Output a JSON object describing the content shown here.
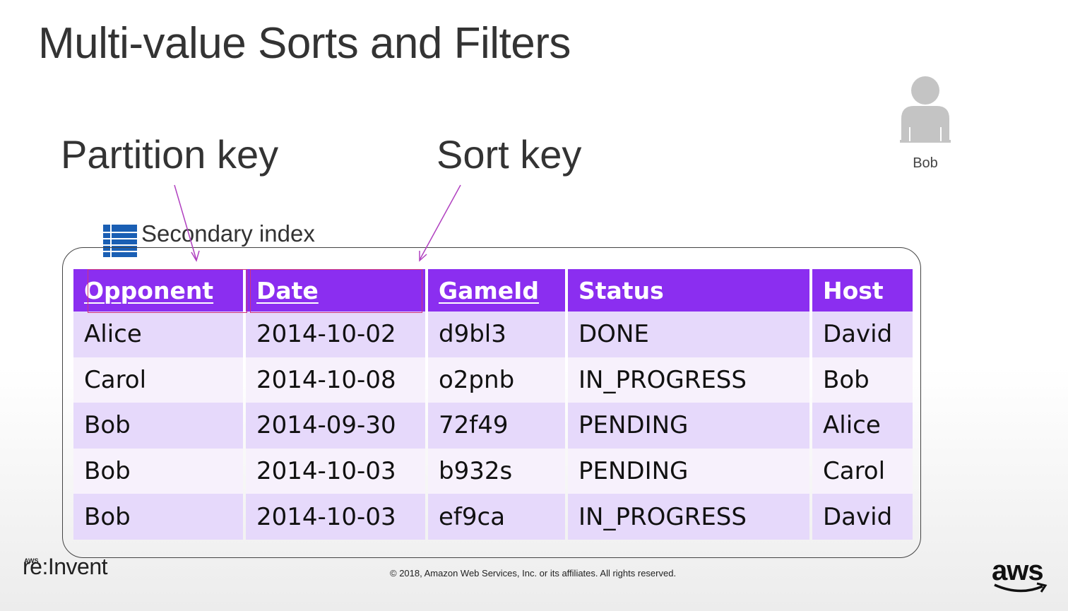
{
  "slide": {
    "title": "Multi-value Sorts and Filters",
    "partition_key_label": "Partition key",
    "sort_key_label": "Sort key",
    "index_label": "Secondary index",
    "user_name": "Bob",
    "copyright": "© 2018, Amazon Web Services, Inc. or its affiliates. All rights reserved.",
    "event_logo": "re:Invent",
    "event_logo_small": "AWS",
    "brand_logo": "aws"
  },
  "table": {
    "headers": [
      "Opponent",
      "Date",
      "GameId",
      "Status",
      "Host"
    ],
    "rows": [
      [
        "Alice",
        "2014-10-02",
        "d9bl3",
        "DONE",
        "David"
      ],
      [
        "Carol",
        "2014-10-08",
        "o2pnb",
        "IN_PROGRESS",
        "Bob"
      ],
      [
        "Bob",
        "2014-09-30",
        "72f49",
        "PENDING",
        "Alice"
      ],
      [
        "Bob",
        "2014-10-03",
        "b932s",
        "PENDING",
        "Carol"
      ],
      [
        "Bob",
        "2014-10-03",
        "ef9ca",
        "IN_PROGRESS",
        "David"
      ]
    ]
  },
  "colors": {
    "header_bg": "#8b2ef0",
    "row_dark": "#e6d9fb",
    "row_light": "#f7f1fc",
    "highlight_border": "#d0357c",
    "arrow": "#b040c0"
  }
}
